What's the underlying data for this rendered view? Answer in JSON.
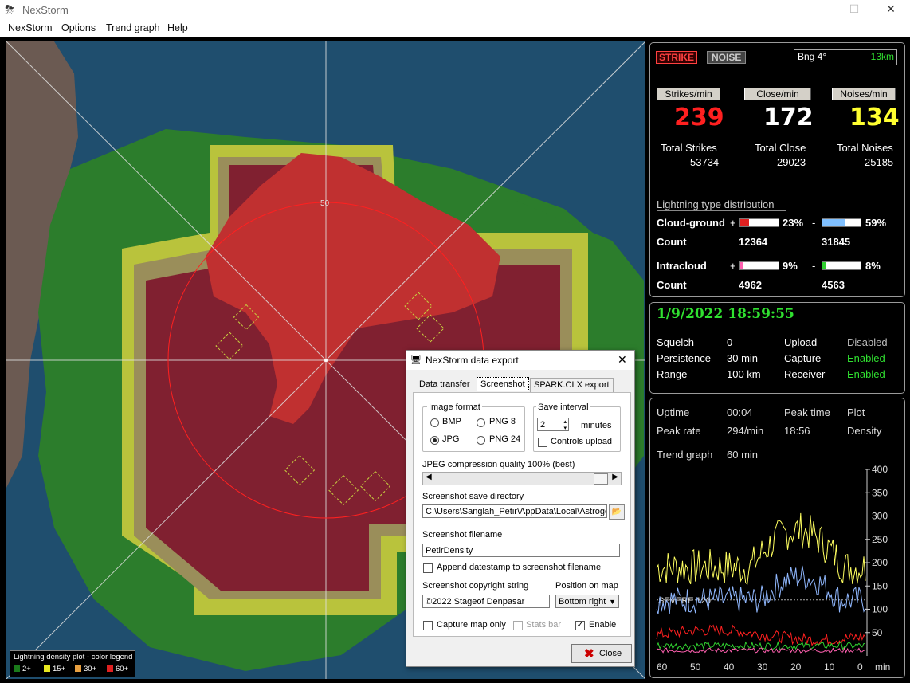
{
  "window": {
    "title": "NexStorm",
    "min": "—",
    "max": "☐",
    "close": "✕"
  },
  "menu": [
    "NexStorm",
    "Options",
    "Trend graph",
    "Help"
  ],
  "map": {
    "range_label": "50",
    "legend_title": "Lightning density plot - color legend",
    "legend": [
      {
        "label": "2+",
        "color": "#1a7a1a"
      },
      {
        "label": "15+",
        "color": "#e8e820"
      },
      {
        "label": "30+",
        "color": "#e8a040"
      },
      {
        "label": "60+",
        "color": "#e02020"
      }
    ]
  },
  "stats": {
    "strike_label": "STRIKE",
    "noise_label": "NOISE",
    "bearing": "Bng 4°",
    "distance": "13km",
    "strikes_per_min_label": "Strikes/min",
    "close_per_min_label": "Close/min",
    "noises_per_min_label": "Noises/min",
    "strikes_per_min": "239",
    "close_per_min": "172",
    "noises_per_min": "134",
    "total_strikes_label": "Total Strikes",
    "total_close_label": "Total Close",
    "total_noises_label": "Total Noises",
    "total_strikes": "53734",
    "total_close": "29023",
    "total_noises": "25185",
    "dist_title": "Lightning type distribution",
    "cg_label": "Cloud-ground",
    "plus": "+",
    "minus": "-",
    "cg_pos_pct": "23%",
    "cg_neg_pct": "59%",
    "cg_pos_frac": 0.23,
    "cg_neg_frac": 0.59,
    "count_label": "Count",
    "cg_pos_count": "12364",
    "cg_neg_count": "31845",
    "ic_label": "Intracloud",
    "ic_pos_pct": "9%",
    "ic_neg_pct": "8%",
    "ic_pos_frac": 0.09,
    "ic_neg_frac": 0.08,
    "ic_pos_count": "4962",
    "ic_neg_count": "4563"
  },
  "status": {
    "datetime": "1/9/2022 18:59:55",
    "squelch_label": "Squelch",
    "squelch": "0",
    "persistence_label": "Persistence",
    "persistence": "30 min",
    "range_label": "Range",
    "range": "100 km",
    "upload_label": "Upload",
    "upload": "Disabled",
    "capture_label": "Capture",
    "capture": "Enabled",
    "receiver_label": "Receiver",
    "receiver": "Enabled"
  },
  "trend": {
    "uptime_label": "Uptime",
    "uptime": "00:04",
    "peak_time_label": "Peak time",
    "peak_time": "18:56",
    "plot_label": "Plot",
    "plot": "Density",
    "peak_rate_label": "Peak rate",
    "peak_rate": "294/min",
    "graph_label": "Trend graph",
    "graph_range": "60 min",
    "severe_label": "SEVERE 120",
    "y_ticks": [
      "400",
      "350",
      "300",
      "250",
      "200",
      "150",
      "100",
      "50"
    ],
    "x_ticks": [
      "60",
      "50",
      "40",
      "30",
      "20",
      "10",
      "0"
    ],
    "x_unit": "min"
  },
  "dialog": {
    "title": "NexStorm data export",
    "close_x": "✕",
    "tabs": [
      "Data transfer",
      "Screenshot",
      "SPARK.CLX export"
    ],
    "image_format_label": "Image format",
    "bmp": "BMP",
    "png8": "PNG 8",
    "jpg": "JPG",
    "png24": "PNG 24",
    "save_interval_label": "Save interval",
    "interval_value": "2",
    "minutes": "minutes",
    "controls_upload": "Controls upload",
    "jpeg_quality_label": "JPEG compression quality 100%  (best)",
    "jpeg_quality_frac": 1.0,
    "dir_label": "Screenshot save directory",
    "dir_value": "C:\\Users\\Sanglah_Petir\\AppData\\Local\\Astroge",
    "filename_label": "Screenshot filename",
    "filename_value": "PetirDensity",
    "append_datestamp": "Append datestamp to screenshot filename",
    "copyright_label": "Screenshot copyright string",
    "copyright_value": "©2022 Stageof Denpasar",
    "position_label": "Position on map",
    "position_value": "Bottom right",
    "capture_map_only": "Capture map only",
    "stats_bar": "Stats bar",
    "enable": "Enable",
    "close_button": "Close"
  }
}
